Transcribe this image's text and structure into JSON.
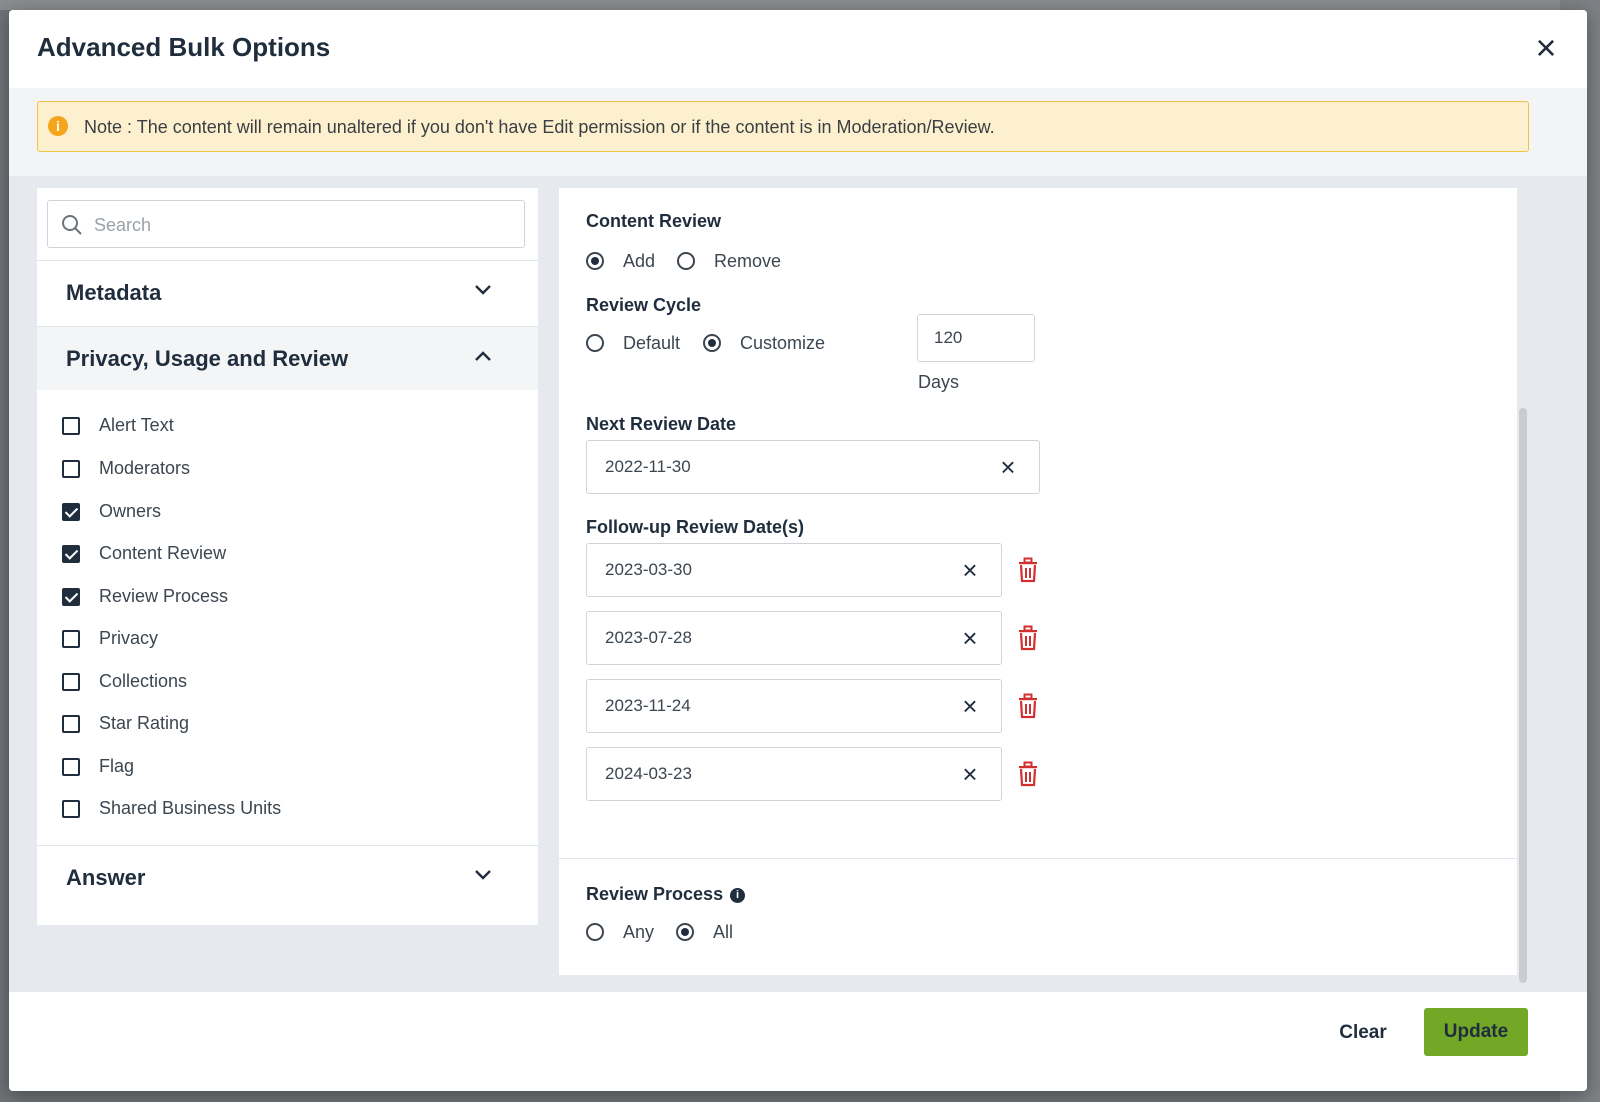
{
  "modal": {
    "title": "Advanced Bulk Options",
    "close_icon": "close-icon"
  },
  "note": {
    "icon": "info-icon",
    "text": "Note : The content will remain unaltered if you don't have Edit permission or if the content is in Moderation/Review.",
    "icon_glyph": "i"
  },
  "sidebar": {
    "search_placeholder": "Search",
    "sections": [
      {
        "label": "Metadata",
        "expanded": false
      },
      {
        "label": "Privacy, Usage and Review",
        "expanded": true
      },
      {
        "label": "Answer",
        "expanded": false
      }
    ],
    "options": [
      {
        "label": "Alert Text",
        "checked": false
      },
      {
        "label": "Moderators",
        "checked": false
      },
      {
        "label": "Owners",
        "checked": true
      },
      {
        "label": "Content Review",
        "checked": true
      },
      {
        "label": "Review Process",
        "checked": true
      },
      {
        "label": "Privacy",
        "checked": false
      },
      {
        "label": "Collections",
        "checked": false
      },
      {
        "label": "Star Rating",
        "checked": false
      },
      {
        "label": "Flag",
        "checked": false
      },
      {
        "label": "Shared Business Units",
        "checked": false
      }
    ]
  },
  "content_review": {
    "label": "Content Review",
    "options": [
      {
        "label": "Add",
        "selected": true
      },
      {
        "label": "Remove",
        "selected": false
      }
    ]
  },
  "review_cycle": {
    "label": "Review Cycle",
    "options": [
      {
        "label": "Default",
        "selected": false
      },
      {
        "label": "Customize",
        "selected": true
      }
    ],
    "days_value": "120",
    "days_label": "Days"
  },
  "next_review": {
    "label": "Next Review Date",
    "value": "2022-11-30"
  },
  "followup": {
    "label": "Follow-up Review Date(s)",
    "dates": [
      "2023-03-30",
      "2023-07-28",
      "2023-11-24",
      "2024-03-23"
    ]
  },
  "review_process": {
    "label": "Review Process",
    "info_glyph": "i",
    "options": [
      {
        "label": "Any",
        "selected": false
      },
      {
        "label": "All",
        "selected": true
      }
    ]
  },
  "footer": {
    "clear_label": "Clear",
    "update_label": "Update"
  },
  "colors": {
    "accent": "#72a826",
    "danger": "#d0302f",
    "warning_bg": "#fdf0cf",
    "text": "#1f2d3d"
  },
  "glyphs": {
    "close": "×"
  }
}
